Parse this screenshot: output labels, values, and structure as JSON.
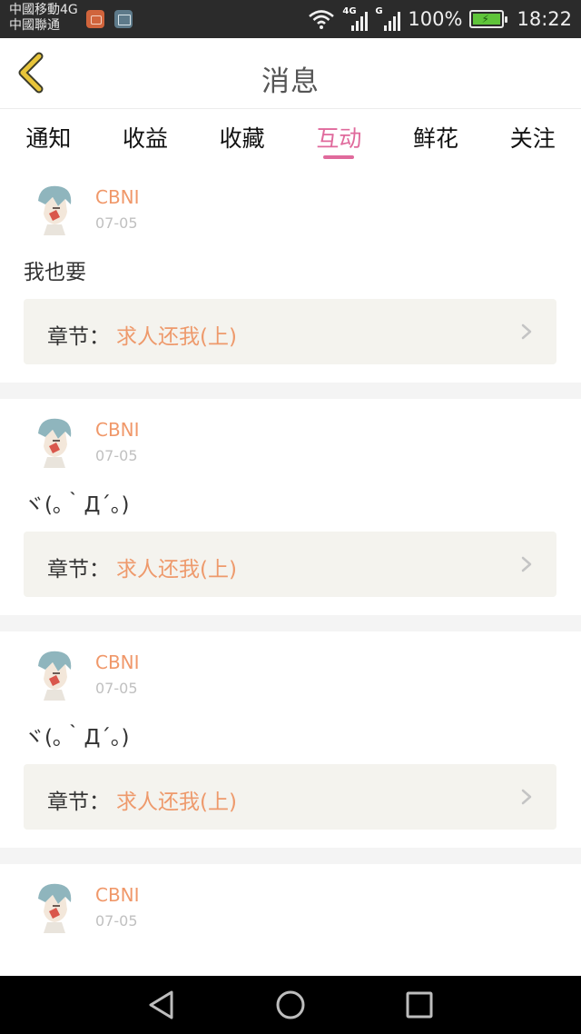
{
  "status_bar": {
    "carrier_line1": "中國移動4G",
    "carrier_line2": "中國聯通",
    "net1": "4G",
    "net2": "G",
    "battery": "100%",
    "time": "18:22"
  },
  "header": {
    "title": "消息"
  },
  "tabs": [
    {
      "label": "通知"
    },
    {
      "label": "收益"
    },
    {
      "label": "收藏"
    },
    {
      "label": "互动"
    },
    {
      "label": "鲜花"
    },
    {
      "label": "关注"
    }
  ],
  "active_tab": "互动",
  "messages": [
    {
      "user": "CBNI",
      "date": "07-05",
      "text": "我也要",
      "chapter_label": "章节：",
      "chapter_title": "求人还我(上)"
    },
    {
      "user": "CBNI",
      "date": "07-05",
      "text": "ヾ(｡｀Д´｡)",
      "chapter_label": "章节：",
      "chapter_title": "求人还我(上)"
    },
    {
      "user": "CBNI",
      "date": "07-05",
      "text": "ヾ(｡｀Д´｡)",
      "chapter_label": "章节：",
      "chapter_title": "求人还我(上)"
    },
    {
      "user": "CBNI",
      "date": "07-05"
    }
  ],
  "colors": {
    "accent_tab": "#e06a9c",
    "username": "#f0986a",
    "chapter_link": "#ee9a6c",
    "back_arrow": "#e8c53a"
  },
  "icons": [
    "back-arrow-icon",
    "wifi-icon",
    "signal-icon",
    "battery-icon",
    "chevron-right-icon",
    "nav-back-icon",
    "nav-home-icon",
    "nav-recents-icon"
  ]
}
